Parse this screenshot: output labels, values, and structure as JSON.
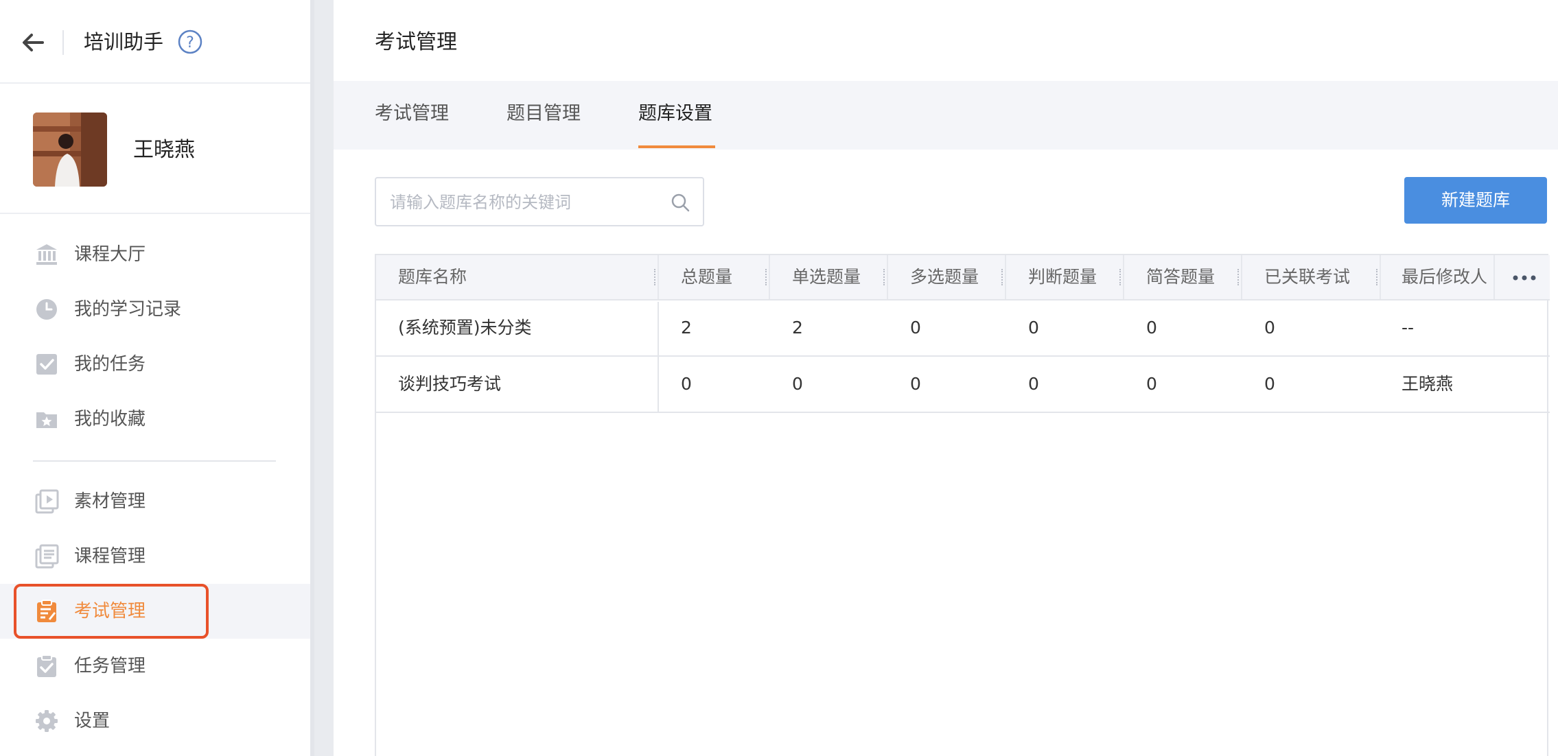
{
  "header": {
    "app_title": "培训助手"
  },
  "profile": {
    "name": "王晓燕"
  },
  "nav": {
    "group1": [
      "课程大厅",
      "我的学习记录",
      "我的任务",
      "我的收藏"
    ],
    "group2": [
      "素材管理",
      "课程管理",
      "考试管理",
      "任务管理",
      "设置"
    ],
    "active": "考试管理"
  },
  "icons": [
    "back-arrow-icon",
    "help-icon",
    "bank-icon",
    "clock-icon",
    "checkbox-icon",
    "star-folder-icon",
    "video-icon",
    "course-list-icon",
    "exam-clipboard-icon",
    "task-clipboard-icon",
    "gear-icon",
    "search-icon",
    "more-icon"
  ],
  "colors": {
    "accent": "#f08a3c",
    "primary_button": "#4a8ee0",
    "highlight_outline": "#e8512a"
  },
  "main": {
    "page_title": "考试管理",
    "tabs": [
      "考试管理",
      "题目管理",
      "题库设置"
    ],
    "active_tab": "题库设置",
    "search_placeholder": "请输入题库名称的关键词",
    "new_button": "新建题库"
  },
  "table": {
    "headers": [
      "题库名称",
      "总题量",
      "单选题量",
      "多选题量",
      "判断题量",
      "简答题量",
      "已关联考试",
      "最后修改人"
    ],
    "rows": [
      [
        "(系统预置)未分类",
        "2",
        "2",
        "0",
        "0",
        "0",
        "0",
        "--"
      ],
      [
        "谈判技巧考试",
        "0",
        "0",
        "0",
        "0",
        "0",
        "0",
        "王晓燕"
      ]
    ]
  }
}
